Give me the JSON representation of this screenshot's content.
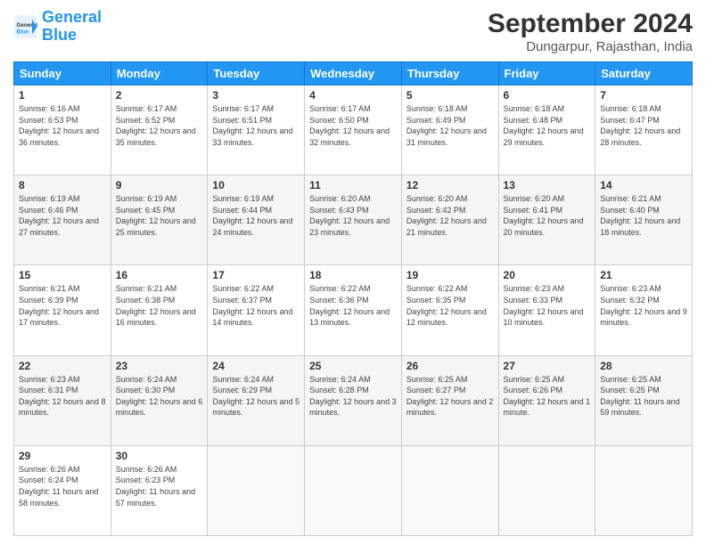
{
  "header": {
    "logo_line1": "General",
    "logo_line2": "Blue",
    "title": "September 2024",
    "subtitle": "Dungarpur, Rajasthan, India"
  },
  "weekdays": [
    "Sunday",
    "Monday",
    "Tuesday",
    "Wednesday",
    "Thursday",
    "Friday",
    "Saturday"
  ],
  "weeks": [
    [
      {
        "day": "1",
        "sunrise": "6:16 AM",
        "sunset": "6:53 PM",
        "daylight": "12 hours and 36 minutes."
      },
      {
        "day": "2",
        "sunrise": "6:17 AM",
        "sunset": "6:52 PM",
        "daylight": "12 hours and 35 minutes."
      },
      {
        "day": "3",
        "sunrise": "6:17 AM",
        "sunset": "6:51 PM",
        "daylight": "12 hours and 33 minutes."
      },
      {
        "day": "4",
        "sunrise": "6:17 AM",
        "sunset": "6:50 PM",
        "daylight": "12 hours and 32 minutes."
      },
      {
        "day": "5",
        "sunrise": "6:18 AM",
        "sunset": "6:49 PM",
        "daylight": "12 hours and 31 minutes."
      },
      {
        "day": "6",
        "sunrise": "6:18 AM",
        "sunset": "6:48 PM",
        "daylight": "12 hours and 29 minutes."
      },
      {
        "day": "7",
        "sunrise": "6:18 AM",
        "sunset": "6:47 PM",
        "daylight": "12 hours and 28 minutes."
      }
    ],
    [
      {
        "day": "8",
        "sunrise": "6:19 AM",
        "sunset": "6:46 PM",
        "daylight": "12 hours and 27 minutes."
      },
      {
        "day": "9",
        "sunrise": "6:19 AM",
        "sunset": "6:45 PM",
        "daylight": "12 hours and 25 minutes."
      },
      {
        "day": "10",
        "sunrise": "6:19 AM",
        "sunset": "6:44 PM",
        "daylight": "12 hours and 24 minutes."
      },
      {
        "day": "11",
        "sunrise": "6:20 AM",
        "sunset": "6:43 PM",
        "daylight": "12 hours and 23 minutes."
      },
      {
        "day": "12",
        "sunrise": "6:20 AM",
        "sunset": "6:42 PM",
        "daylight": "12 hours and 21 minutes."
      },
      {
        "day": "13",
        "sunrise": "6:20 AM",
        "sunset": "6:41 PM",
        "daylight": "12 hours and 20 minutes."
      },
      {
        "day": "14",
        "sunrise": "6:21 AM",
        "sunset": "6:40 PM",
        "daylight": "12 hours and 18 minutes."
      }
    ],
    [
      {
        "day": "15",
        "sunrise": "6:21 AM",
        "sunset": "6:39 PM",
        "daylight": "12 hours and 17 minutes."
      },
      {
        "day": "16",
        "sunrise": "6:21 AM",
        "sunset": "6:38 PM",
        "daylight": "12 hours and 16 minutes."
      },
      {
        "day": "17",
        "sunrise": "6:22 AM",
        "sunset": "6:37 PM",
        "daylight": "12 hours and 14 minutes."
      },
      {
        "day": "18",
        "sunrise": "6:22 AM",
        "sunset": "6:36 PM",
        "daylight": "12 hours and 13 minutes."
      },
      {
        "day": "19",
        "sunrise": "6:22 AM",
        "sunset": "6:35 PM",
        "daylight": "12 hours and 12 minutes."
      },
      {
        "day": "20",
        "sunrise": "6:23 AM",
        "sunset": "6:33 PM",
        "daylight": "12 hours and 10 minutes."
      },
      {
        "day": "21",
        "sunrise": "6:23 AM",
        "sunset": "6:32 PM",
        "daylight": "12 hours and 9 minutes."
      }
    ],
    [
      {
        "day": "22",
        "sunrise": "6:23 AM",
        "sunset": "6:31 PM",
        "daylight": "12 hours and 8 minutes."
      },
      {
        "day": "23",
        "sunrise": "6:24 AM",
        "sunset": "6:30 PM",
        "daylight": "12 hours and 6 minutes."
      },
      {
        "day": "24",
        "sunrise": "6:24 AM",
        "sunset": "6:29 PM",
        "daylight": "12 hours and 5 minutes."
      },
      {
        "day": "25",
        "sunrise": "6:24 AM",
        "sunset": "6:28 PM",
        "daylight": "12 hours and 3 minutes."
      },
      {
        "day": "26",
        "sunrise": "6:25 AM",
        "sunset": "6:27 PM",
        "daylight": "12 hours and 2 minutes."
      },
      {
        "day": "27",
        "sunrise": "6:25 AM",
        "sunset": "6:26 PM",
        "daylight": "12 hours and 1 minute."
      },
      {
        "day": "28",
        "sunrise": "6:25 AM",
        "sunset": "6:25 PM",
        "daylight": "11 hours and 59 minutes."
      }
    ],
    [
      {
        "day": "29",
        "sunrise": "6:26 AM",
        "sunset": "6:24 PM",
        "daylight": "11 hours and 58 minutes."
      },
      {
        "day": "30",
        "sunrise": "6:26 AM",
        "sunset": "6:23 PM",
        "daylight": "11 hours and 57 minutes."
      },
      null,
      null,
      null,
      null,
      null
    ]
  ]
}
